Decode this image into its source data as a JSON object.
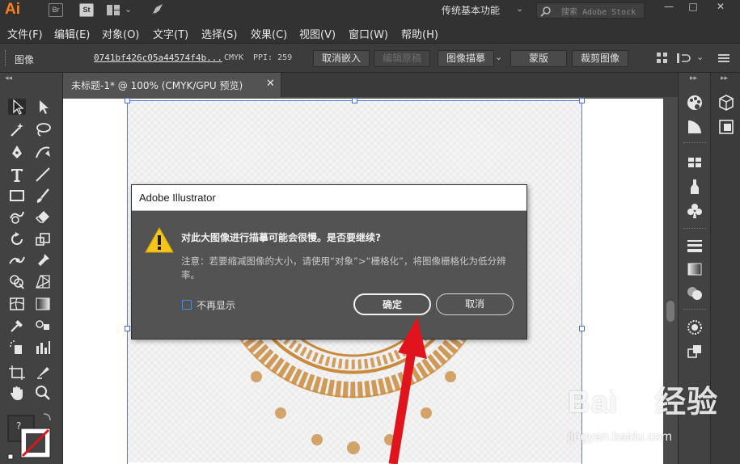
{
  "titlebar": {
    "app_logo": "Ai",
    "bridge_badge": "Br",
    "stock_badge": "St",
    "workspace": "传统基本功能",
    "search_placeholder": "搜索 Adobe Stock",
    "minimize": "—",
    "maximize": "□",
    "close": "✕"
  },
  "menu": [
    "文件(F)",
    "编辑(E)",
    "对象(O)",
    "文字(T)",
    "选择(S)",
    "效果(C)",
    "视图(V)",
    "窗口(W)",
    "帮助(H)"
  ],
  "control_bar": {
    "label": "图像",
    "filename": "0741bf426c05a44574f4b...",
    "color_mode": "CMYK",
    "ppi": "PPI: 259",
    "unembed": "取消嵌入",
    "edit_original": "编辑原稿",
    "image_trace": "图像描摹",
    "mask": "蒙版",
    "crop": "裁剪图像"
  },
  "document_tab": {
    "title": "未标题-1* @ 100% (CMYK/GPU 预览)",
    "close": "✕"
  },
  "dialog": {
    "title": "Adobe Illustrator",
    "message": "对此大图像进行描摹可能会很慢。是否要继续?",
    "note": "注意：若要缩减图像的大小，请使用“对象”>“栅格化”，将图像栅格化为低分辨率。",
    "dont_show_again": "不再显示",
    "ok": "确定",
    "cancel": "取消"
  },
  "swatch": {
    "help": "?"
  },
  "watermark": {
    "logo_left": "Bai",
    "logo_right": "经验",
    "url": "jingyan.baidu.com"
  },
  "colors": {
    "ai_orange": "#ff7f18",
    "selection_blue": "#4a6fd0",
    "annotation_red": "#e0141c",
    "ornament_gold": "#c98a3c"
  }
}
